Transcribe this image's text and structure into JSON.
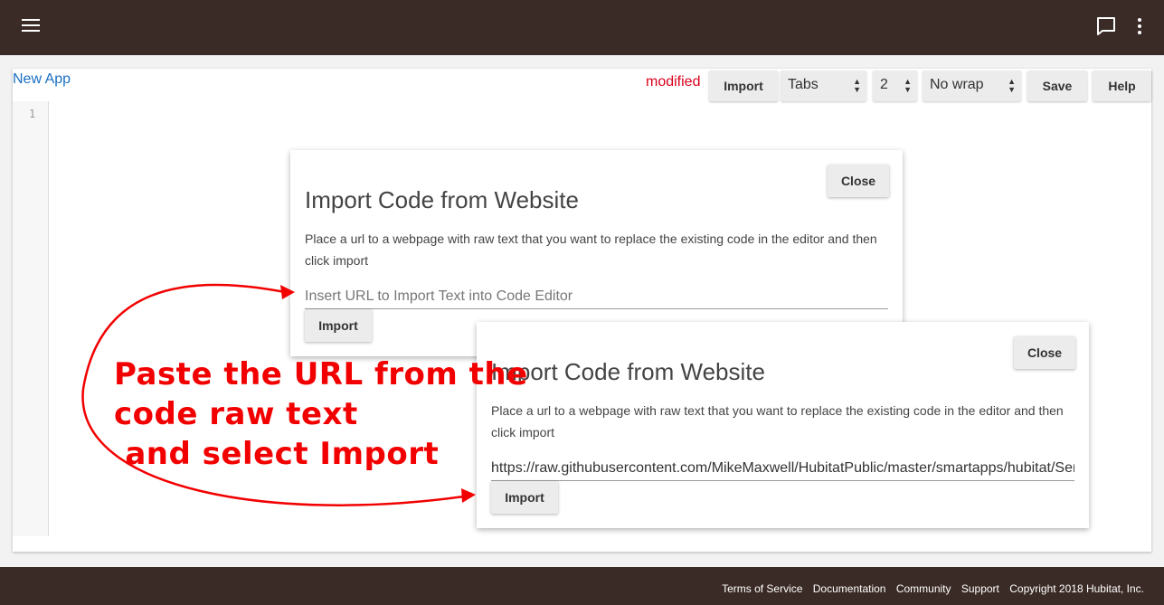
{
  "header": {
    "menu_icon": "hamburger-menu-icon",
    "chat_icon": "chat-bubble-icon",
    "more_icon": "more-vert-icon"
  },
  "editor": {
    "app_title": "New App",
    "status": "modified",
    "toolbar": {
      "import_label": "Import",
      "indent_type": "Tabs",
      "indent_size": "2",
      "wrap_mode": "No wrap",
      "save_label": "Save",
      "help_label": "Help"
    },
    "line_number": "1"
  },
  "dialog_back": {
    "close_label": "Close",
    "title": "Import Code from Website",
    "description": "Place a url to a webpage with raw text that you want to replace the existing code in the editor and then click import",
    "input_placeholder": "Insert URL to Import Text into Code Editor",
    "import_label": "Import"
  },
  "dialog_front": {
    "close_label": "Close",
    "title": "Import Code from Website",
    "description": "Place a url to a webpage with raw text that you want to replace the existing code in the editor and then click import",
    "input_value": "https://raw.githubusercontent.com/MikeMaxwell/HubitatPublic/master/smartapps/hubitat/Ser",
    "import_label": "Import"
  },
  "annotation": {
    "text": "Paste the URL from the\ncode raw text\n and select Import",
    "color": "#f20000"
  },
  "footer": {
    "links": [
      "Terms of Service",
      "Documentation",
      "Community",
      "Support"
    ],
    "copyright": "Copyright 2018 Hubitat, Inc."
  },
  "colors": {
    "bar": "#3b2b26",
    "link": "#1a6fc4",
    "modified": "#d9001b"
  }
}
